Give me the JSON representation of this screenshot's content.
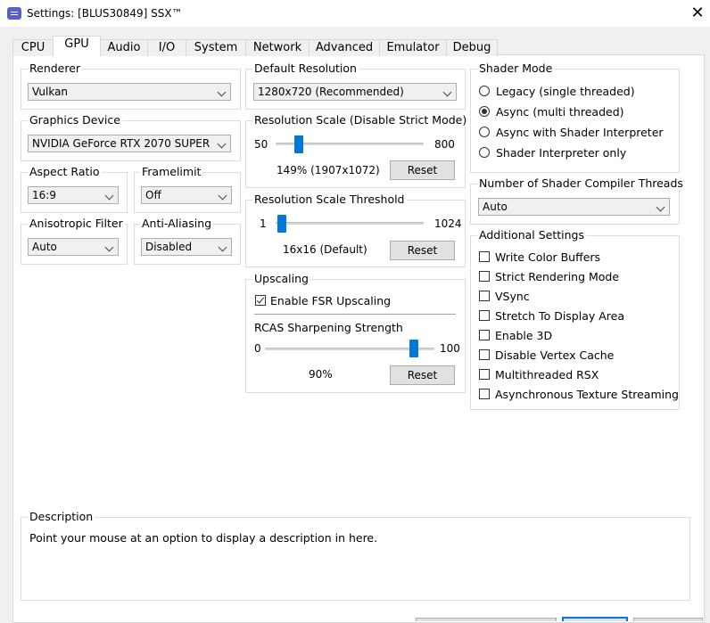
{
  "window": {
    "title": "Settings: [BLUS30849] SSX™"
  },
  "tabs": [
    {
      "label": "CPU"
    },
    {
      "label": "GPU"
    },
    {
      "label": "Audio"
    },
    {
      "label": "I/O"
    },
    {
      "label": "System"
    },
    {
      "label": "Network"
    },
    {
      "label": "Advanced"
    },
    {
      "label": "Emulator"
    },
    {
      "label": "Debug"
    }
  ],
  "active_tab": "GPU",
  "renderer": {
    "label": "Renderer",
    "value": "Vulkan"
  },
  "graphics_device": {
    "label": "Graphics Device",
    "value": "NVIDIA GeForce RTX 2070 SUPER"
  },
  "aspect_ratio": {
    "label": "Aspect Ratio",
    "value": "16:9"
  },
  "framelimit": {
    "label": "Framelimit",
    "value": "Off"
  },
  "anisotropic": {
    "label": "Anisotropic Filter",
    "value": "Auto"
  },
  "anti_aliasing": {
    "label": "Anti-Aliasing",
    "value": "Disabled"
  },
  "default_resolution": {
    "label": "Default Resolution",
    "value": "1280x720 (Recommended)"
  },
  "resolution_scale": {
    "label": "Resolution Scale (Disable Strict Mode)",
    "min": "50",
    "max": "800",
    "value_text": "149% (1907x1072)",
    "reset": "Reset",
    "level": 149
  },
  "resolution_threshold": {
    "label": "Resolution Scale Threshold",
    "min": "1",
    "max": "1024",
    "value_text": "16x16 (Default)",
    "reset": "Reset",
    "level": 16
  },
  "upscaling": {
    "label": "Upscaling",
    "fsr_label": "Enable FSR Upscaling",
    "fsr_checked": true,
    "rcas_label": "RCAS Sharpening Strength",
    "min": "0",
    "max": "100",
    "value_text": "90%",
    "reset": "Reset",
    "level": 90
  },
  "shader_mode": {
    "label": "Shader Mode",
    "options": [
      {
        "label": "Legacy (single threaded)",
        "checked": false
      },
      {
        "label": "Async (multi threaded)",
        "checked": true
      },
      {
        "label": "Async with Shader Interpreter",
        "checked": false
      },
      {
        "label": "Shader Interpreter only",
        "checked": false
      }
    ]
  },
  "compiler_threads": {
    "label": "Number of Shader Compiler Threads",
    "value": "Auto"
  },
  "additional": {
    "label": "Additional Settings",
    "options": [
      {
        "label": "Write Color Buffers",
        "checked": false
      },
      {
        "label": "Strict Rendering Mode",
        "checked": false
      },
      {
        "label": "VSync",
        "checked": false
      },
      {
        "label": "Stretch To Display Area",
        "checked": false
      },
      {
        "label": "Enable 3D",
        "checked": false
      },
      {
        "label": "Disable Vertex Cache",
        "checked": false
      },
      {
        "label": "Multithreaded RSX",
        "checked": false
      },
      {
        "label": "Asynchronous Texture Streaming",
        "checked": false
      }
    ]
  },
  "description": {
    "label": "Description",
    "text": "Point your mouse at an option to display a description in here."
  },
  "colors": {
    "accent": "#0078d7",
    "page_bg": "#ffffff",
    "window_bg": "#f0f0f0",
    "border": "#dcdcdc"
  },
  "icons": {
    "app": "app-icon",
    "close": "close-icon",
    "dropdown": "chevron-down-icon"
  }
}
